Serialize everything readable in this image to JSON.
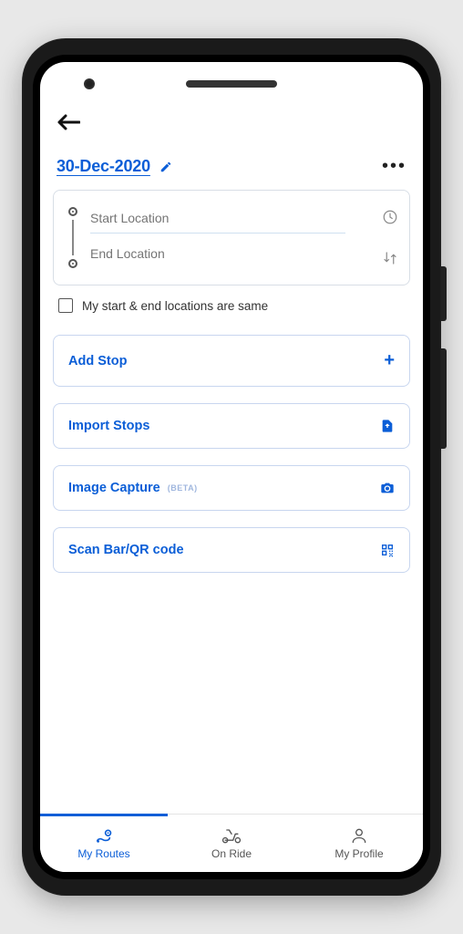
{
  "header": {
    "date": "30-Dec-2020"
  },
  "locations": {
    "start_placeholder": "Start Location",
    "end_placeholder": "End Location",
    "same_label": "My start & end locations are same"
  },
  "actions": {
    "add_stop": "Add Stop",
    "import_stops": "Import Stops",
    "image_capture": "Image Capture",
    "image_capture_badge": "(BETA)",
    "scan_qr": "Scan Bar/QR code"
  },
  "nav": {
    "my_routes": "My Routes",
    "on_ride": "On Ride",
    "my_profile": "My Profile"
  },
  "colors": {
    "primary": "#0b5ed7"
  }
}
